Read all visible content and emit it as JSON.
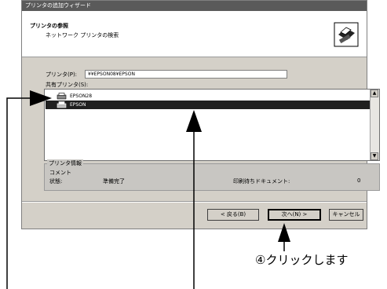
{
  "window": {
    "title": "プリンタの追加ウィザード"
  },
  "header": {
    "title": "プリンタの参照",
    "subtitle": "ネットワーク プリンタの検索",
    "icon": "printer-wizard-icon"
  },
  "printer_field": {
    "label": "プリンタ(P):",
    "value": "¥¥EPSON08¥EPSON"
  },
  "shared_printers": {
    "label": "共有プリンタ(S):",
    "items": [
      {
        "label": "EPSON28",
        "icon": "network-printer-icon"
      },
      {
        "label": "EPSON",
        "icon": "printer-icon",
        "selected": true
      }
    ]
  },
  "printer_info": {
    "label": "プリンタ情報",
    "comment_label": "コメント",
    "status_label": "状態:",
    "status_value": "準備完了",
    "docs_label": "印刷待ちドキュメント:",
    "docs_value": "0"
  },
  "buttons": {
    "back": "< 戻る(B)",
    "next": "次へ(N) >",
    "cancel": "キャンセル"
  },
  "annotation": "④クリックします"
}
